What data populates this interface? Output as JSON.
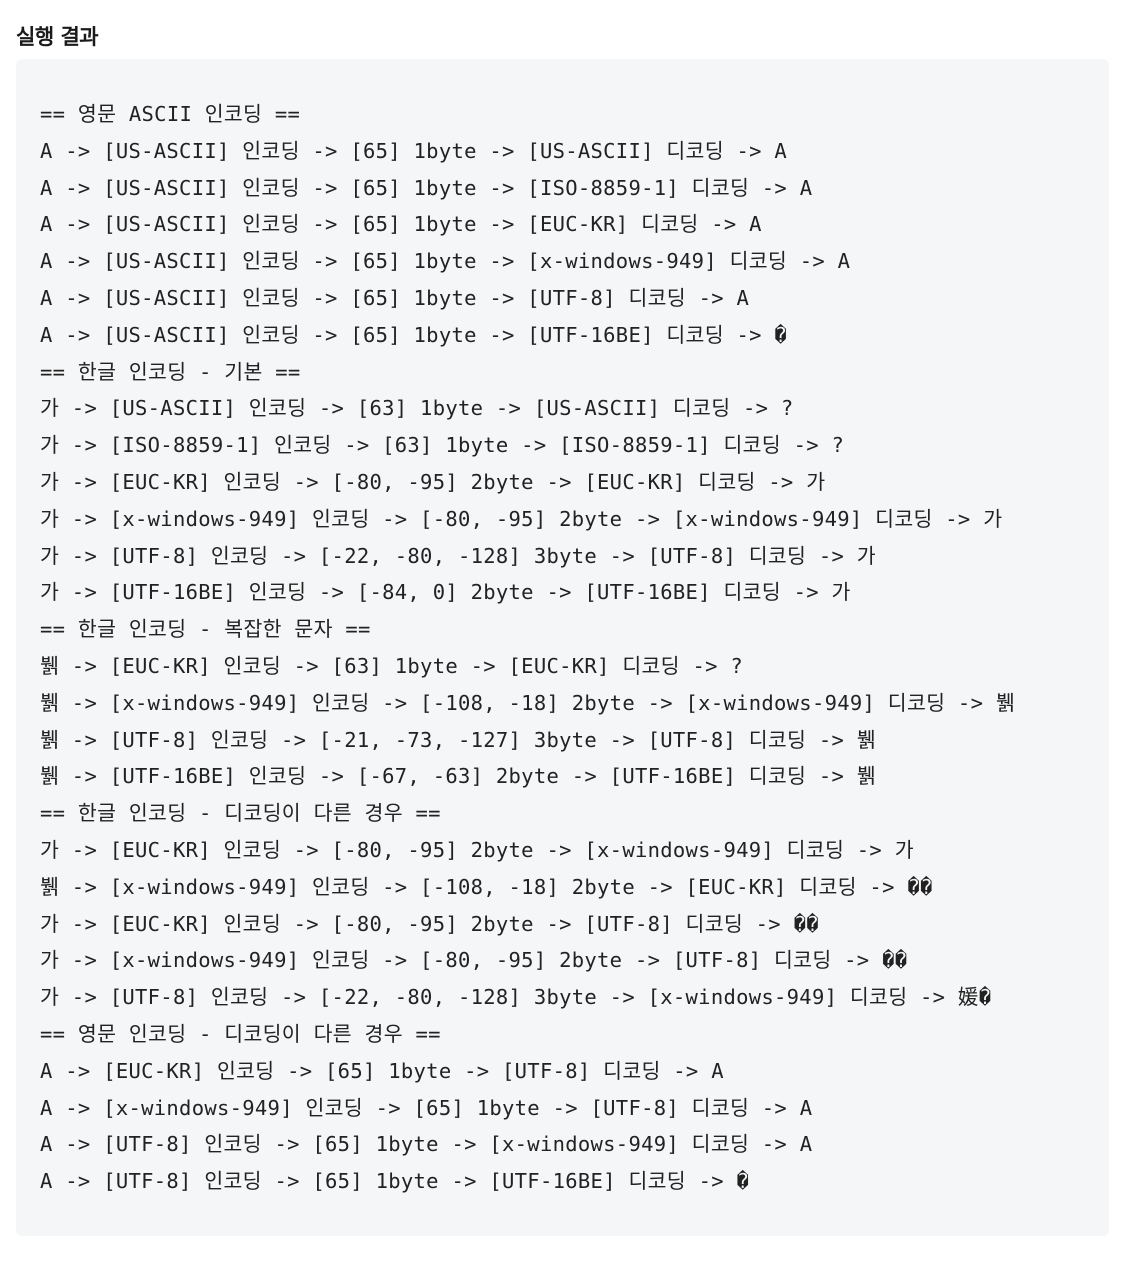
{
  "heading": "실행 결과",
  "output_lines": [
    "== 영문 ASCII 인코딩 ==",
    "A -> [US-ASCII] 인코딩 -> [65] 1byte -> [US-ASCII] 디코딩 -> A",
    "A -> [US-ASCII] 인코딩 -> [65] 1byte -> [ISO-8859-1] 디코딩 -> A",
    "A -> [US-ASCII] 인코딩 -> [65] 1byte -> [EUC-KR] 디코딩 -> A",
    "A -> [US-ASCII] 인코딩 -> [65] 1byte -> [x-windows-949] 디코딩 -> A",
    "A -> [US-ASCII] 인코딩 -> [65] 1byte -> [UTF-8] 디코딩 -> A",
    "A -> [US-ASCII] 인코딩 -> [65] 1byte -> [UTF-16BE] 디코딩 -> �",
    "== 한글 인코딩 - 기본 ==",
    "가 -> [US-ASCII] 인코딩 -> [63] 1byte -> [US-ASCII] 디코딩 -> ?",
    "가 -> [ISO-8859-1] 인코딩 -> [63] 1byte -> [ISO-8859-1] 디코딩 -> ?",
    "가 -> [EUC-KR] 인코딩 -> [-80, -95] 2byte -> [EUC-KR] 디코딩 -> 가",
    "가 -> [x-windows-949] 인코딩 -> [-80, -95] 2byte -> [x-windows-949] 디코딩 -> 가",
    "가 -> [UTF-8] 인코딩 -> [-22, -80, -128] 3byte -> [UTF-8] 디코딩 -> 가",
    "가 -> [UTF-16BE] 인코딩 -> [-84, 0] 2byte -> [UTF-16BE] 디코딩 -> 가",
    "== 한글 인코딩 - 복잡한 문자 ==",
    "뷁 -> [EUC-KR] 인코딩 -> [63] 1byte -> [EUC-KR] 디코딩 -> ?",
    "뷁 -> [x-windows-949] 인코딩 -> [-108, -18] 2byte -> [x-windows-949] 디코딩 -> 뷁",
    "뷁 -> [UTF-8] 인코딩 -> [-21, -73, -127] 3byte -> [UTF-8] 디코딩 -> 뷁",
    "뷁 -> [UTF-16BE] 인코딩 -> [-67, -63] 2byte -> [UTF-16BE] 디코딩 -> 뷁",
    "== 한글 인코딩 - 디코딩이 다른 경우 ==",
    "가 -> [EUC-KR] 인코딩 -> [-80, -95] 2byte -> [x-windows-949] 디코딩 -> 가",
    "뷁 -> [x-windows-949] 인코딩 -> [-108, -18] 2byte -> [EUC-KR] 디코딩 -> ��",
    "가 -> [EUC-KR] 인코딩 -> [-80, -95] 2byte -> [UTF-8] 디코딩 -> ��",
    "가 -> [x-windows-949] 인코딩 -> [-80, -95] 2byte -> [UTF-8] 디코딩 -> ��",
    "가 -> [UTF-8] 인코딩 -> [-22, -80, -128] 3byte -> [x-windows-949] 디코딩 -> 媛�",
    "== 영문 인코딩 - 디코딩이 다른 경우 ==",
    "A -> [EUC-KR] 인코딩 -> [65] 1byte -> [UTF-8] 디코딩 -> A",
    "A -> [x-windows-949] 인코딩 -> [65] 1byte -> [UTF-8] 디코딩 -> A",
    "A -> [UTF-8] 인코딩 -> [65] 1byte -> [x-windows-949] 디코딩 -> A",
    "A -> [UTF-8] 인코딩 -> [65] 1byte -> [UTF-16BE] 디코딩 -> �"
  ]
}
